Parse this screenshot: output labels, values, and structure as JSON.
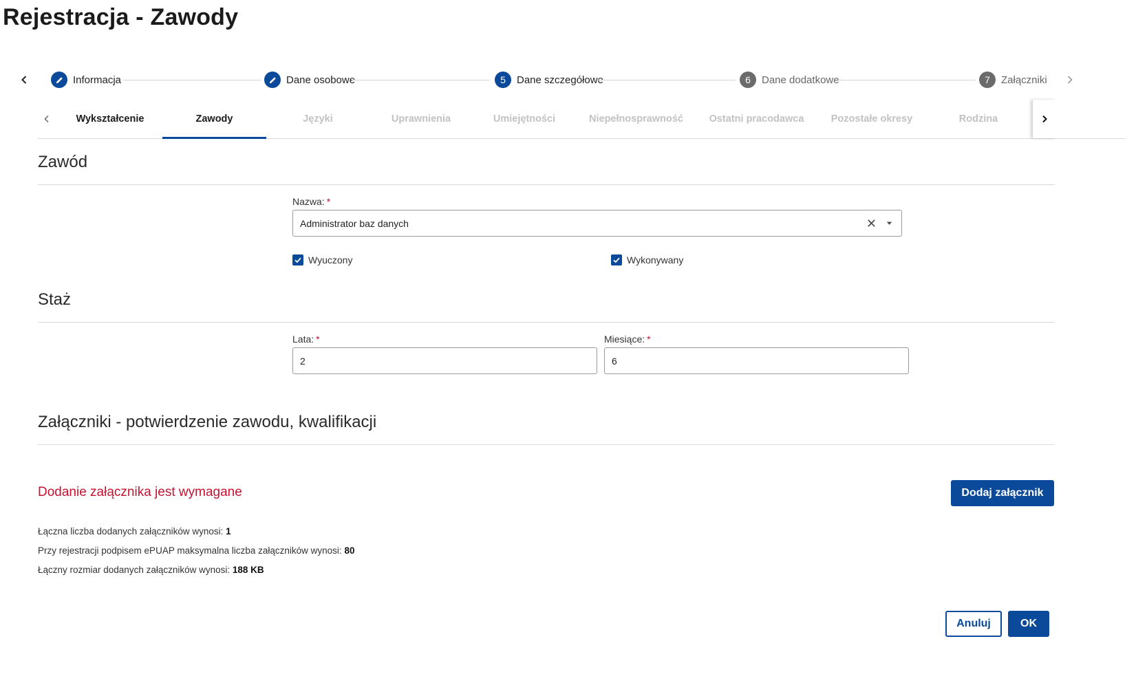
{
  "page": {
    "title": "Rejestracja - Zawody"
  },
  "stepper": {
    "prev_icon": "chevron-left-icon",
    "next_icon": "chevron-right-icon",
    "steps": [
      {
        "label": "Informacja",
        "status": "done",
        "icon": "pencil-icon"
      },
      {
        "label": "Dane osobowe",
        "status": "done",
        "icon": "pencil-icon"
      },
      {
        "number": "5",
        "label": "Dane szczegółowe",
        "status": "active"
      },
      {
        "number": "6",
        "label": "Dane dodatkowe",
        "status": "todo"
      },
      {
        "number": "7",
        "label": "Załączniki",
        "status": "todo"
      }
    ]
  },
  "tabs": {
    "items": [
      {
        "label": "Wykształcenie",
        "state": "enabled"
      },
      {
        "label": "Zawody",
        "state": "active"
      },
      {
        "label": "Języki",
        "state": "disabled"
      },
      {
        "label": "Uprawnienia",
        "state": "disabled"
      },
      {
        "label": "Umiejętności",
        "state": "disabled"
      },
      {
        "label": "Niepełnosprawność",
        "state": "disabled"
      },
      {
        "label": "Ostatni pracodawca",
        "state": "disabled"
      },
      {
        "label": "Pozostałe okresy",
        "state": "disabled"
      },
      {
        "label": "Rodzina",
        "state": "disabled"
      }
    ]
  },
  "profession": {
    "section_title": "Zawód",
    "name_label": "Nazwa:",
    "required_mark": "*",
    "name_value": "Administrator baz danych",
    "clear_icon": "close-icon",
    "dropdown_icon": "caret-down-icon",
    "learned_label": "Wyuczony",
    "learned_checked": true,
    "practiced_label": "Wykonywany",
    "practiced_checked": true
  },
  "experience": {
    "section_title": "Staż",
    "years_label": "Lata:",
    "years_value": "2",
    "months_label": "Miesiące:",
    "months_value": "6",
    "required_mark": "*"
  },
  "attachments": {
    "section_title": "Załączniki - potwierdzenie zawodu, kwalifikacji",
    "required_message": "Dodanie załącznika jest wymagane",
    "add_button": "Dodaj załącznik",
    "count_text": "Łączna liczba dodanych załączników wynosi:",
    "count_value": "1",
    "max_text": "Przy rejestracji podpisem ePUAP maksymalna liczba załączników wynosi:",
    "max_value": "80",
    "size_text": "Łączny rozmiar dodanych załączników wynosi:",
    "size_value": "188 KB"
  },
  "footer": {
    "cancel_label": "Anuluj",
    "ok_label": "OK"
  },
  "colors": {
    "primary": "#0b4a9a",
    "error": "#c8102e",
    "step_todo": "#6b6b6b",
    "disabled_tab": "#c2c2c2"
  }
}
